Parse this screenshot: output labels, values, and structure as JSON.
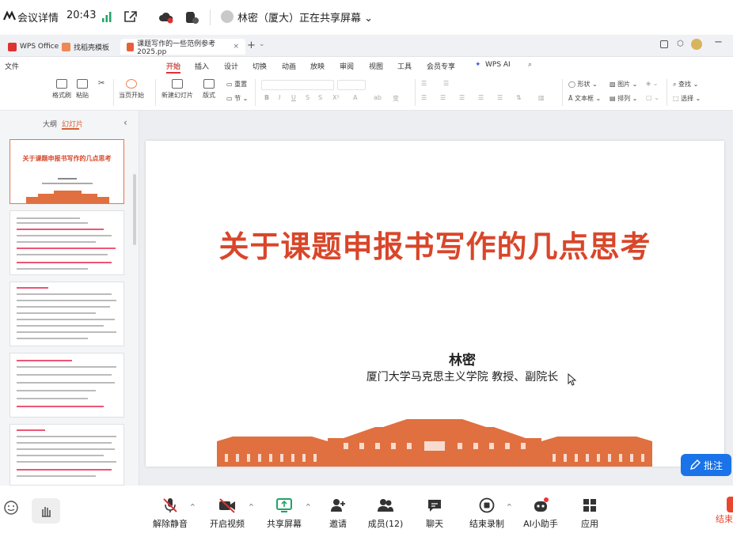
{
  "meeting_top": {
    "title": "会议详情",
    "time": "20:43",
    "sharing_status": "林密（厦大）正在共享屏幕"
  },
  "wps": {
    "tabs": [
      "WPS Office",
      "找稻壳模板",
      "课题写作的一些范例参考2025.pp"
    ],
    "menu": [
      "文件",
      "开始",
      "插入",
      "设计",
      "切换",
      "动画",
      "放映",
      "审阅",
      "视图",
      "工具",
      "会员专享",
      "WPS AI"
    ],
    "ribbon": {
      "format_painter": "格式刷",
      "paste": "粘贴",
      "start_current": "当页开始",
      "new_slide": "新建幻灯片",
      "layout": "版式",
      "reset": "重置",
      "section": "节",
      "shape": "形状",
      "image": "图片",
      "textbox": "文本框",
      "arrange": "排列",
      "find": "查找",
      "select": "选择"
    },
    "sidebar_tabs": [
      "大纲",
      "幻灯片"
    ],
    "slide": {
      "title": "关于课题申报书写作的几点思考",
      "author": "林密",
      "affiliation": "厦门大学马克思主义学院  教授、副院长"
    },
    "thumb1_title": "关于课题申报书写作的几点思考"
  },
  "annotate_button": "批注",
  "meeting_bottom": [
    {
      "label": "解除静音"
    },
    {
      "label": "开启视频"
    },
    {
      "label": "共享屏幕"
    },
    {
      "label": "邀请"
    },
    {
      "label": "成员(12)"
    },
    {
      "label": "聊天"
    },
    {
      "label": "结束录制"
    },
    {
      "label": "AI小助手"
    },
    {
      "label": "应用"
    },
    {
      "label": "结束"
    }
  ],
  "colors": {
    "accent_red": "#d9462a",
    "annotate_blue": "#1a73e8",
    "share_green": "#21a366"
  }
}
